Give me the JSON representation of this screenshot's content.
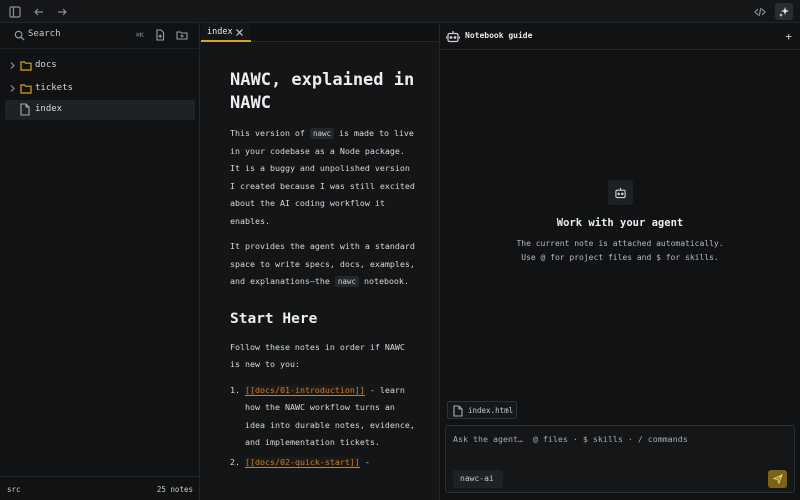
{
  "topbar": {
    "icons": [
      "sidebar-toggle-icon",
      "arrow-left-icon",
      "arrow-right-icon",
      "code-icon",
      "sparkle-icon"
    ]
  },
  "sidebar": {
    "search_label": "Search",
    "search_shortcut": "⌘K",
    "items": [
      {
        "label": "docs",
        "type": "folder"
      },
      {
        "label": "tickets",
        "type": "folder"
      },
      {
        "label": "index",
        "type": "file",
        "selected": true
      }
    ],
    "footer_left": "src",
    "footer_right": "25 notes"
  },
  "editor": {
    "tab_label": "index",
    "title": "NAWC, explained in NAWC",
    "para1_a": "This version of ",
    "para1_code": "nawc",
    "para1_b": " is made to live in your codebase as a Node package. It is a buggy and unpolished version I created because I was still excited about the AI coding workflow it enables.",
    "para2_a": "It provides the agent with a standard space to write specs, docs, examples, and explanations—the ",
    "para2_code": "nawc",
    "para2_b": " notebook.",
    "heading2": "Start Here",
    "para3": "Follow these notes in order if NAWC is new to you:",
    "list": [
      {
        "num": "1.",
        "link": "[[docs/01-introduction]]",
        "text": " - learn how the NAWC workflow turns an idea into durable notes, evidence, and implementation tickets."
      },
      {
        "num": "2.",
        "link": "[[docs/02-quick-start]]",
        "text": " -"
      }
    ]
  },
  "agent": {
    "title": "Notebook guide",
    "plus": "+",
    "empty_title": "Work with your agent",
    "empty_line1": "The current note is attached automatically.",
    "empty_line2": "Use @ for project files and $ for skills.",
    "attachment": "index.html",
    "composer_placeholder": "Ask the agent…  @ files · $ skills · / commands",
    "model": "nawc-ai"
  },
  "colors": {
    "accent": "#d9a520",
    "link": "#d07a2c",
    "send_button": "#7a6318"
  }
}
